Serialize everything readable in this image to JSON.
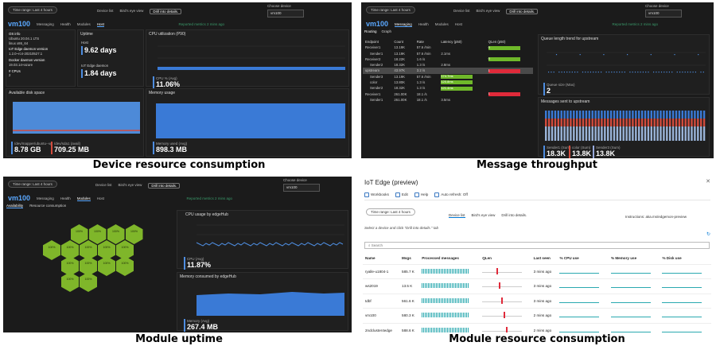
{
  "captions": {
    "tl": "Device resource consumption",
    "tr": "Message throughput",
    "bl": "Module uptime",
    "br": "Module resource consumption"
  },
  "common": {
    "time_range": "Time range: Last 4 hours",
    "device_list": "Device list",
    "birds_eye": "Bird's eye view",
    "drill": "Drill into details.",
    "choose_device": "Choose device",
    "device": "vm100",
    "title": "vm100",
    "reported": "Reported metrics 2 mins ago",
    "messaging": "Messaging",
    "health": "Health",
    "modules": "Modules",
    "host": "Host"
  },
  "tl": {
    "os_info_label": "OS info",
    "os_info": "Ubuntu 20.04.1 LTS",
    "os_info2": "linux x86_64",
    "edge_ver_label": "IoT Edge daemon version",
    "edge_ver": "1.2.0~rc4-20210527.1",
    "docker_label": "Docker daemon version",
    "docker_ver": "19.03.14+azure",
    "cpus_label": "# CPUs",
    "cpus": "2",
    "uptime_label": "Uptime",
    "host_label": "Host",
    "host_uptime": "9.62 days",
    "edge_daemon_label": "IoT Edge daemon",
    "edge_uptime": "1.84 days",
    "cpu_title": "CPU utilization (P90)",
    "cpu_kpi_label": "CPU % (Avg)",
    "cpu_kpi": "11.06%",
    "disk_title": "Available disk space",
    "disk_kpi1_label": "/dev/mapper/ubuntu--vg",
    "disk_kpi1": "8.78 GB",
    "disk_kpi2_label": "/dev/sda1 (avail)",
    "disk_kpi2": "709.25 MB",
    "mem_title": "Memory usage",
    "mem_kpi_label": "Memory used (Avg)",
    "mem_kpi": "898.3 MB",
    "x_ticks": [
      "5 AM",
      "6 AM",
      "7 AM",
      "8 AM"
    ]
  },
  "tr": {
    "routing": "Routing",
    "graph": "Graph",
    "headers": [
      "Endpoint",
      "Count",
      "Rate",
      "Latency (p50)",
      "QLen (p50)"
    ],
    "rows": [
      [
        "Receiver1",
        "13.19K",
        "57.6 /min",
        "",
        "0"
      ],
      [
        "Sender1",
        "13.19K",
        "57.6 /min",
        "2.1ms",
        ""
      ],
      [
        "Receiver2",
        "18.22K",
        "1.6 /s",
        "",
        "0"
      ],
      [
        "Sender2",
        "18.32K",
        "1.3 /s",
        "2.8ms",
        ""
      ],
      [
        "upstream",
        "43.97K",
        "3.2 /s",
        "",
        "1"
      ],
      [
        "Sender3",
        "13.19K",
        "57.6 /min",
        "174.7ms",
        ""
      ],
      [
        "color",
        "13.80K",
        "1.3 /s",
        "120.8ms",
        ""
      ],
      [
        "Sender2",
        "18.32K",
        "1.3 /s",
        "121.4ms",
        ""
      ],
      [
        "Receiver1",
        "261.00K",
        "18.1 /s",
        "",
        "1"
      ],
      [
        "Sender1",
        "261.00K",
        "18.1 /s",
        "3.5ms",
        ""
      ]
    ],
    "qlen_title": "Queue length trend for upstream",
    "qlen_kpi_label": "Queue size (Max)",
    "qlen_kpi": "2",
    "sent_title": "Messages sent to upstream",
    "k1_label": "Sender1 (Sum)",
    "k1": "18.3K",
    "k2_label": "color (Sum)",
    "k2": "13.8K",
    "k3_label": "Sender3 (Sum)",
    "k3": "13.8K"
  },
  "bl": {
    "availability": "Availability",
    "resource": "Resource consumption",
    "cpu_title": "CPU usage by edgeHub",
    "cpu_kpi_label": "CPU (Avg)",
    "cpu_kpi": "11.87%",
    "mem_title": "Memory consumed by edgeHub",
    "mem_kpi_label": "Memory (Avg)",
    "mem_kpi": "267.4 MB",
    "hex_value": "100%"
  },
  "br": {
    "title": "IoT Edge (preview)",
    "workbooks": "Workbooks",
    "edit": "Edit",
    "help": "Help",
    "auto_refresh": "Auto refresh: Off",
    "hint": "Select a device and click \"Drill into details.\" tab",
    "search": "Search",
    "instructions": "Instructions: aka.ms/edgemon-preview",
    "headers": [
      "Name",
      "Msgs",
      "Processed messages",
      "QLen",
      "Last seen",
      "% CPU use",
      "% Memory use",
      "% Disk use"
    ],
    "rows": [
      [
        "ryalle-u1804-1",
        "585.7 K",
        "3 mins ago"
      ],
      [
        "ws2019",
        "13.5 K",
        "3 mins ago"
      ],
      [
        "tdbf",
        "561.6 K",
        "3 mins ago"
      ],
      [
        "vm100",
        "580.3 K",
        "2 mins ago"
      ],
      [
        "2ndcluster4edge",
        "588.6 K",
        "2 mins ago"
      ],
      [
        "vm101",
        "47",
        "1 min ago"
      ]
    ]
  }
}
